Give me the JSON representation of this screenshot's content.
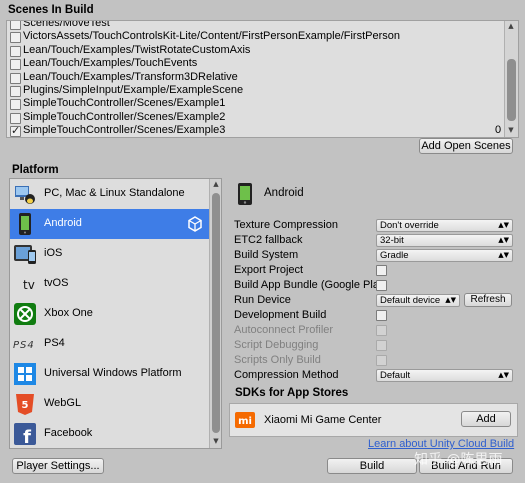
{
  "scenes": {
    "title": "Scenes In Build",
    "items": [
      {
        "label": "Scenes/MoveTest",
        "checked": false,
        "index": ""
      },
      {
        "label": "VictorsAssets/TouchControlsKit-Lite/Content/FirstPersonExample/FirstPerson",
        "checked": false,
        "index": ""
      },
      {
        "label": "Lean/Touch/Examples/TwistRotateCustomAxis",
        "checked": false,
        "index": ""
      },
      {
        "label": "Lean/Touch/Examples/TouchEvents",
        "checked": false,
        "index": ""
      },
      {
        "label": "Lean/Touch/Examples/Transform3DRelative",
        "checked": false,
        "index": ""
      },
      {
        "label": "Plugins/SimpleInput/Example/ExampleScene",
        "checked": false,
        "index": ""
      },
      {
        "label": "SimpleTouchController/Scenes/Example1",
        "checked": false,
        "index": ""
      },
      {
        "label": "SimpleTouchController/Scenes/Example2",
        "checked": false,
        "index": ""
      },
      {
        "label": "SimpleTouchController/Scenes/Example3",
        "checked": true,
        "index": "0"
      }
    ],
    "add_open_scenes": "Add Open Scenes"
  },
  "platform": {
    "title": "Platform",
    "items": [
      {
        "label": "PC, Mac & Linux Standalone",
        "icon": "pc-mac-linux-icon"
      },
      {
        "label": "Android",
        "icon": "android-icon",
        "selected": true
      },
      {
        "label": "iOS",
        "icon": "ios-icon"
      },
      {
        "label": "tvOS",
        "icon": "tvos-icon"
      },
      {
        "label": "Xbox One",
        "icon": "xbox-icon"
      },
      {
        "label": "PS4",
        "icon": "ps4-icon"
      },
      {
        "label": "Universal Windows Platform",
        "icon": "windows-icon"
      },
      {
        "label": "WebGL",
        "icon": "html5-icon"
      },
      {
        "label": "Facebook",
        "icon": "facebook-icon"
      }
    ]
  },
  "settings": {
    "platform_name": "Android",
    "texture_compression": {
      "label": "Texture Compression",
      "value": "Don't override"
    },
    "etc2_fallback": {
      "label": "ETC2 fallback",
      "value": "32-bit"
    },
    "build_system": {
      "label": "Build System",
      "value": "Gradle"
    },
    "export_project": {
      "label": "Export Project"
    },
    "build_app_bundle": {
      "label": "Build App Bundle (Google Pla"
    },
    "run_device": {
      "label": "Run Device",
      "value": "Default device",
      "refresh": "Refresh"
    },
    "development_build": {
      "label": "Development Build"
    },
    "autoconnect_profiler": {
      "label": "Autoconnect Profiler"
    },
    "script_debugging": {
      "label": "Script Debugging"
    },
    "scripts_only_build": {
      "label": "Scripts Only Build"
    },
    "compression_method": {
      "label": "Compression Method",
      "value": "Default"
    }
  },
  "sdks": {
    "title": "SDKs for App Stores",
    "item": "Xiaomi Mi Game Center",
    "add": "Add"
  },
  "footer": {
    "cloud_link": "Learn about Unity Cloud Build",
    "player_settings": "Player Settings...",
    "build": "Build",
    "build_and_run": "Build And Run"
  },
  "watermark": "知乎 @陈思雨",
  "colors": {
    "selected": "#3e7de7",
    "link": "#2f5fcf",
    "background": "#c2c2c2"
  }
}
